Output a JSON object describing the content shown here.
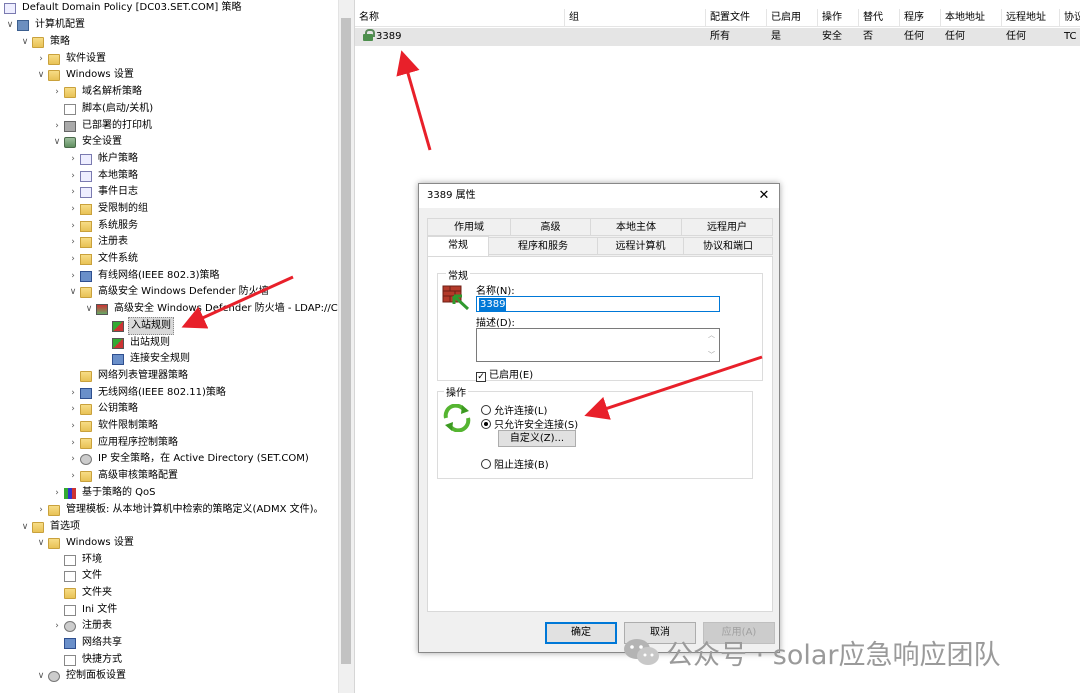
{
  "tree": {
    "nodes": [
      {
        "label": "Default Domain Policy [DC03.SET.COM] 策略",
        "icon": "policy-doc-icon"
      },
      {
        "label": "计算机配置",
        "icon": "computer-icon"
      },
      {
        "label": "策略",
        "icon": "folder-icon"
      },
      {
        "label": "软件设置",
        "icon": "folder-icon"
      },
      {
        "label": "Windows 设置",
        "icon": "folder-icon"
      },
      {
        "label": "域名解析策略",
        "icon": "folder-icon"
      },
      {
        "label": "脚本(启动/关机)",
        "icon": "script-icon"
      },
      {
        "label": "已部署的打印机",
        "icon": "printer-icon"
      },
      {
        "label": "安全设置",
        "icon": "security-icon"
      },
      {
        "label": "帐户策略",
        "icon": "policy-icon"
      },
      {
        "label": "本地策略",
        "icon": "policy-icon"
      },
      {
        "label": "事件日志",
        "icon": "policy-icon"
      },
      {
        "label": "受限制的组",
        "icon": "lock-folder-icon"
      },
      {
        "label": "系统服务",
        "icon": "lock-folder-icon"
      },
      {
        "label": "注册表",
        "icon": "lock-folder-icon"
      },
      {
        "label": "文件系统",
        "icon": "lock-folder-icon"
      },
      {
        "label": "有线网络(IEEE 802.3)策略",
        "icon": "network-icon"
      },
      {
        "label": "高级安全 Windows Defender 防火墙",
        "icon": "folder-icon"
      },
      {
        "label": "高级安全 Windows Defender 防火墙 - LDAP://C",
        "icon": "firewall-icon"
      },
      {
        "label": "入站规则",
        "icon": "inbound-rules-icon"
      },
      {
        "label": "出站规则",
        "icon": "outbound-rules-icon"
      },
      {
        "label": "连接安全规则",
        "icon": "connection-rules-icon"
      },
      {
        "label": "网络列表管理器策略",
        "icon": "folder-icon"
      },
      {
        "label": "无线网络(IEEE 802.11)策略",
        "icon": "wireless-icon"
      },
      {
        "label": "公钥策略",
        "icon": "folder-icon"
      },
      {
        "label": "软件限制策略",
        "icon": "folder-icon"
      },
      {
        "label": "应用程序控制策略",
        "icon": "folder-icon"
      },
      {
        "label": "IP 安全策略，在 Active Directory (SET.COM)",
        "icon": "ipsec-icon"
      },
      {
        "label": "高级审核策略配置",
        "icon": "folder-icon"
      },
      {
        "label": "基于策略的 QoS",
        "icon": "qos-chart-icon"
      },
      {
        "label": "管理模板: 从本地计算机中检索的策略定义(ADMX 文件)。",
        "icon": "folder-icon"
      },
      {
        "label": "首选项",
        "icon": "folder-icon"
      },
      {
        "label": "Windows 设置",
        "icon": "folder-icon"
      },
      {
        "label": "环境",
        "icon": "environment-icon"
      },
      {
        "label": "文件",
        "icon": "file-icon"
      },
      {
        "label": "文件夹",
        "icon": "folder-icon"
      },
      {
        "label": "Ini 文件",
        "icon": "ini-file-icon"
      },
      {
        "label": "注册表",
        "icon": "registry-icon"
      },
      {
        "label": "网络共享",
        "icon": "network-share-icon"
      },
      {
        "label": "快捷方式",
        "icon": "shortcut-icon"
      },
      {
        "label": "控制面板设置",
        "icon": "control-panel-icon"
      }
    ]
  },
  "list": {
    "columns": [
      "名称",
      "组",
      "配置文件",
      "已启用",
      "操作",
      "替代",
      "程序",
      "本地地址",
      "远程地址",
      "协议"
    ],
    "rows": [
      {
        "name": "3389",
        "group": "",
        "profile": "所有",
        "enabled": "是",
        "action": "安全",
        "override": "否",
        "program": "任何",
        "local": "任何",
        "remote": "任何",
        "protocol": "TC"
      }
    ]
  },
  "dialog": {
    "title": "3389 属性",
    "close_glyph": "✕",
    "tabs_top": [
      "作用域",
      "高级",
      "本地主体",
      "远程用户"
    ],
    "tabs_bottom": [
      "常规",
      "程序和服务",
      "远程计算机",
      "协议和端口"
    ],
    "active_tab": "常规",
    "general_group": "常规",
    "name_label": "名称(N):",
    "name_value": "3389",
    "desc_label": "描述(D):",
    "desc_value": "",
    "enabled_label": "已启用(E)",
    "enabled_checked": true,
    "action_group": "操作",
    "options": [
      "允许连接(L)",
      "只允许安全连接(S)",
      "阻止连接(B)"
    ],
    "selected_option": "只允许安全连接(S)",
    "customize_button": "自定义(Z)...",
    "ok_button": "确定",
    "cancel_button": "取消",
    "apply_button": "应用(A)"
  },
  "watermark": {
    "text": "公众号 · solar应急响应团队"
  },
  "colors": {
    "accent": "#0078d7",
    "annotation_arrow": "#e8202a",
    "selected_row": "#e5e5e5"
  }
}
